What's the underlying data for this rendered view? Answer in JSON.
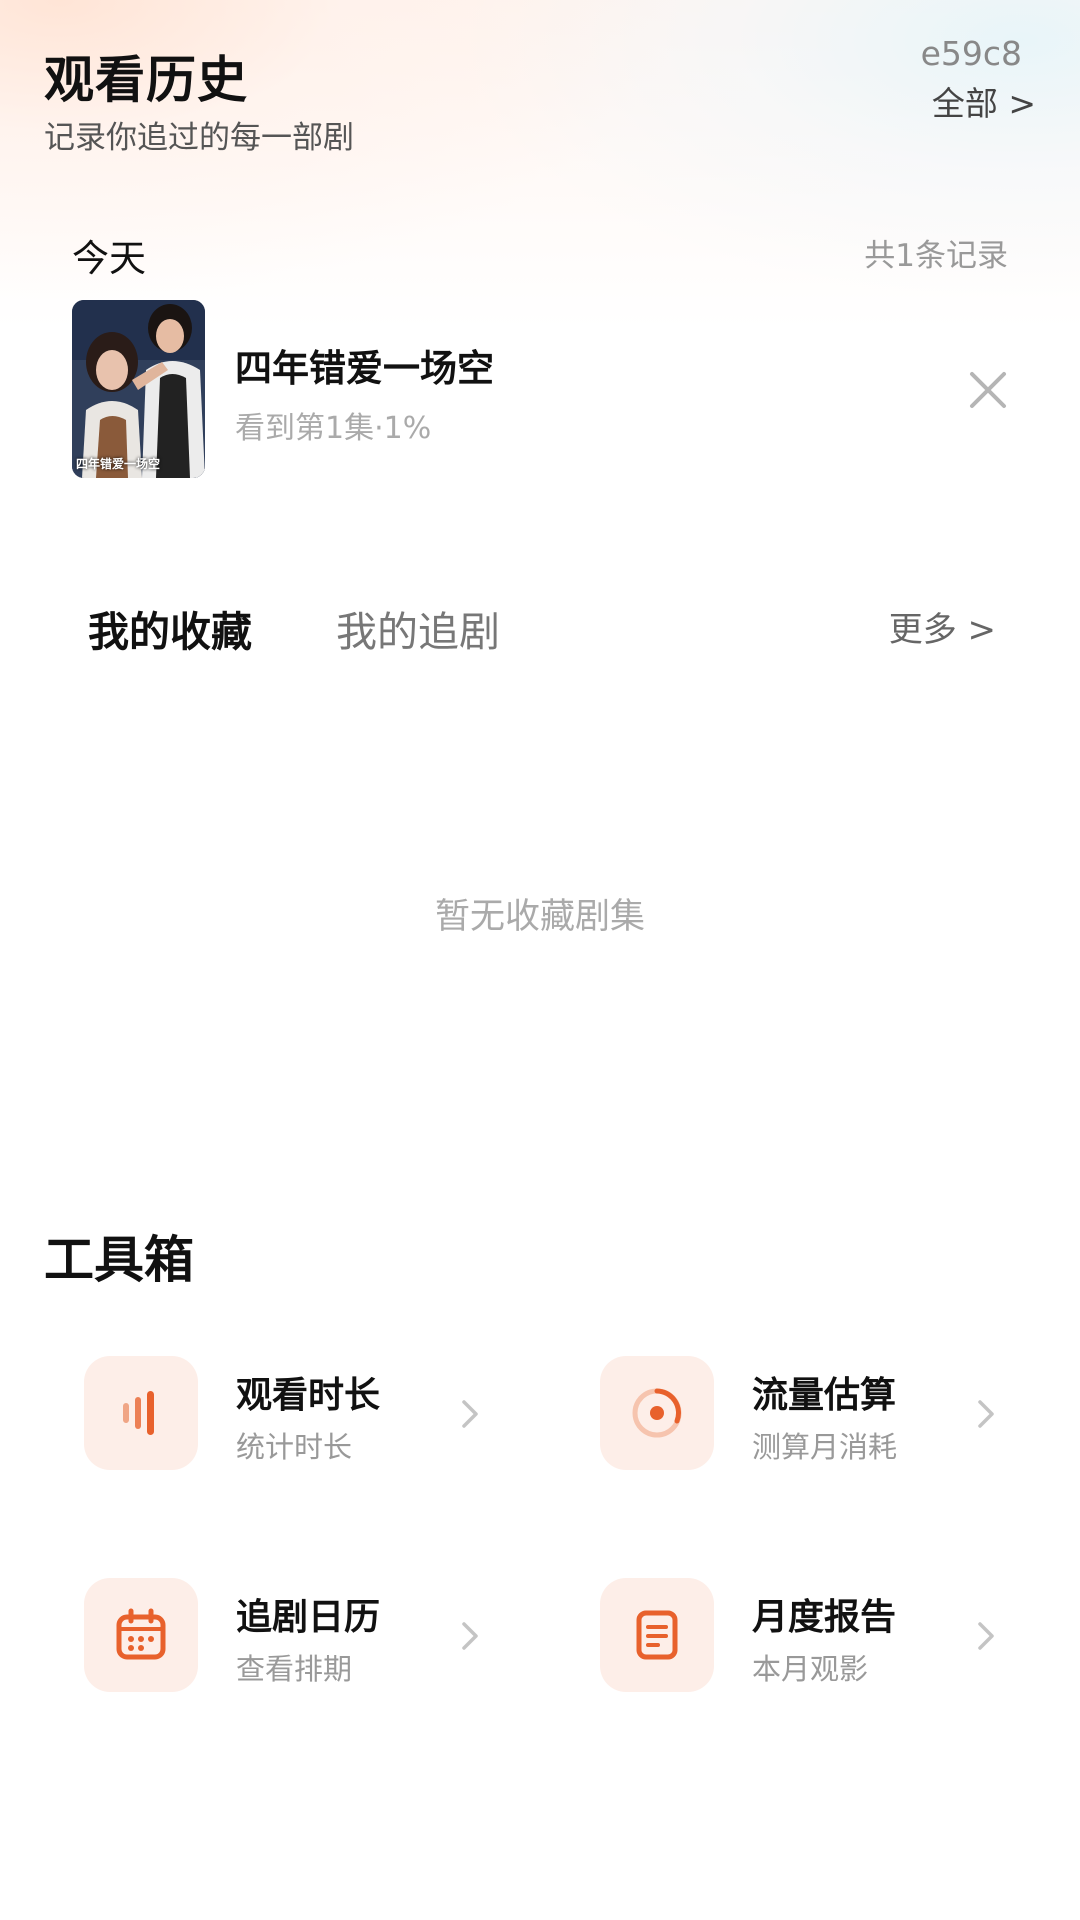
{
  "header": {
    "title": "观看历史",
    "subtitle": "记录你追过的每一部剧",
    "user_id": "e59c8",
    "all_link": "全部 >"
  },
  "history": {
    "day_label": "今天",
    "count_text": "共1条记录",
    "items": [
      {
        "title": "四年错爱一场空",
        "progress": "看到第1集·1%",
        "thumb_caption": "四年错爱一场空"
      }
    ]
  },
  "collection": {
    "tabs": [
      {
        "label": "我的收藏"
      },
      {
        "label": "我的追剧"
      }
    ],
    "more_link": "更多 >",
    "empty_text": "暂无收藏剧集"
  },
  "toolbox": {
    "title": "工具箱",
    "tools": [
      {
        "name": "观看时长",
        "desc": "统计时长",
        "icon": "bar-chart-icon"
      },
      {
        "name": "流量估算",
        "desc": "测算月消耗",
        "icon": "progress-ring-icon"
      },
      {
        "name": "追剧日历",
        "desc": "查看排期",
        "icon": "calendar-icon"
      },
      {
        "name": "月度报告",
        "desc": "本月观影",
        "icon": "document-icon"
      }
    ]
  },
  "colors": {
    "accent": "#e8612c",
    "icon_bg": "#fdeee8"
  }
}
